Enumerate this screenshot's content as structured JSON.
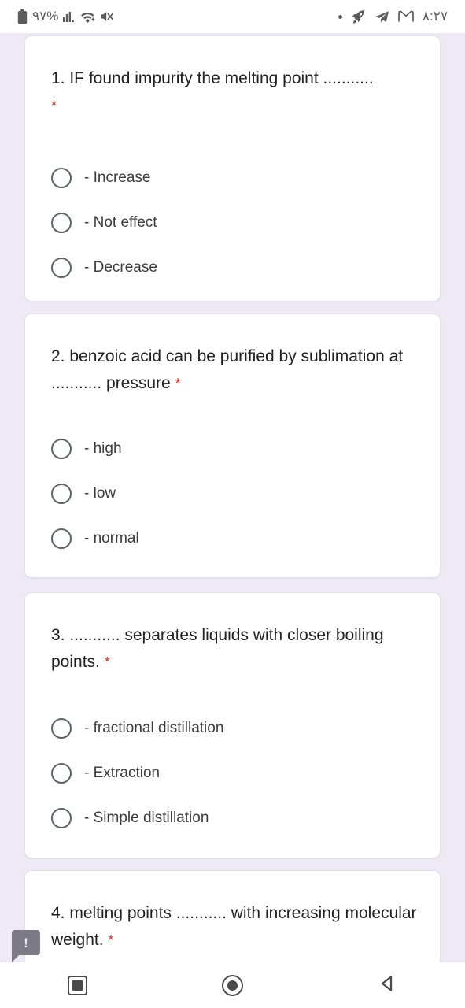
{
  "status_bar": {
    "battery_icon": "battery-icon",
    "battery_text": "٩٧%",
    "signal_icon": "signal-bars-icon",
    "wifi_icon": "wifi-icon",
    "mute_icon": "volume-muted-icon",
    "dot_icon": "notification-dot-icon",
    "rocket_icon": "rocket-icon",
    "telegram_icon": "telegram-send-icon",
    "gmail_icon": "gmail-icon",
    "time": "٨:٢٧"
  },
  "form": {
    "questions": [
      {
        "title": "1. IF found impurity the melting point ...........",
        "required_mark": "*",
        "required_inline": false,
        "options": [
          {
            "label": "- Increase",
            "selected": false
          },
          {
            "label": "- Not effect",
            "selected": false
          },
          {
            "label": "- Decrease",
            "selected": false
          }
        ]
      },
      {
        "title": "2. benzoic acid can be purified by sublimation at ........... pressure",
        "required_mark": "*",
        "required_inline": true,
        "options": [
          {
            "label": "- high",
            "selected": false
          },
          {
            "label": "- low",
            "selected": false
          },
          {
            "label": "- normal",
            "selected": false
          }
        ]
      },
      {
        "title": "3. ........... separates liquids with closer boiling points.",
        "required_mark": "*",
        "required_inline": true,
        "options": [
          {
            "label": "- fractional distillation",
            "selected": false
          },
          {
            "label": "- Extraction",
            "selected": false
          },
          {
            "label": "- Simple distillation",
            "selected": false
          }
        ]
      },
      {
        "title": "4. melting points ........... with increasing molecular weight.",
        "required_mark": "*",
        "required_inline": true,
        "options": []
      }
    ]
  },
  "floating_badge": {
    "icon": "exclamation-icon",
    "mark": "!"
  },
  "nav_bar": {
    "recents_icon": "recents-square-icon",
    "home_icon": "home-circle-icon",
    "back_icon": "back-triangle-icon"
  },
  "colors": {
    "page_background": "#EDEAF5",
    "card_background": "#FFFFFF",
    "required_asterisk": "#C0392B",
    "text_primary": "#212121",
    "radio_border": "#5F6368"
  }
}
